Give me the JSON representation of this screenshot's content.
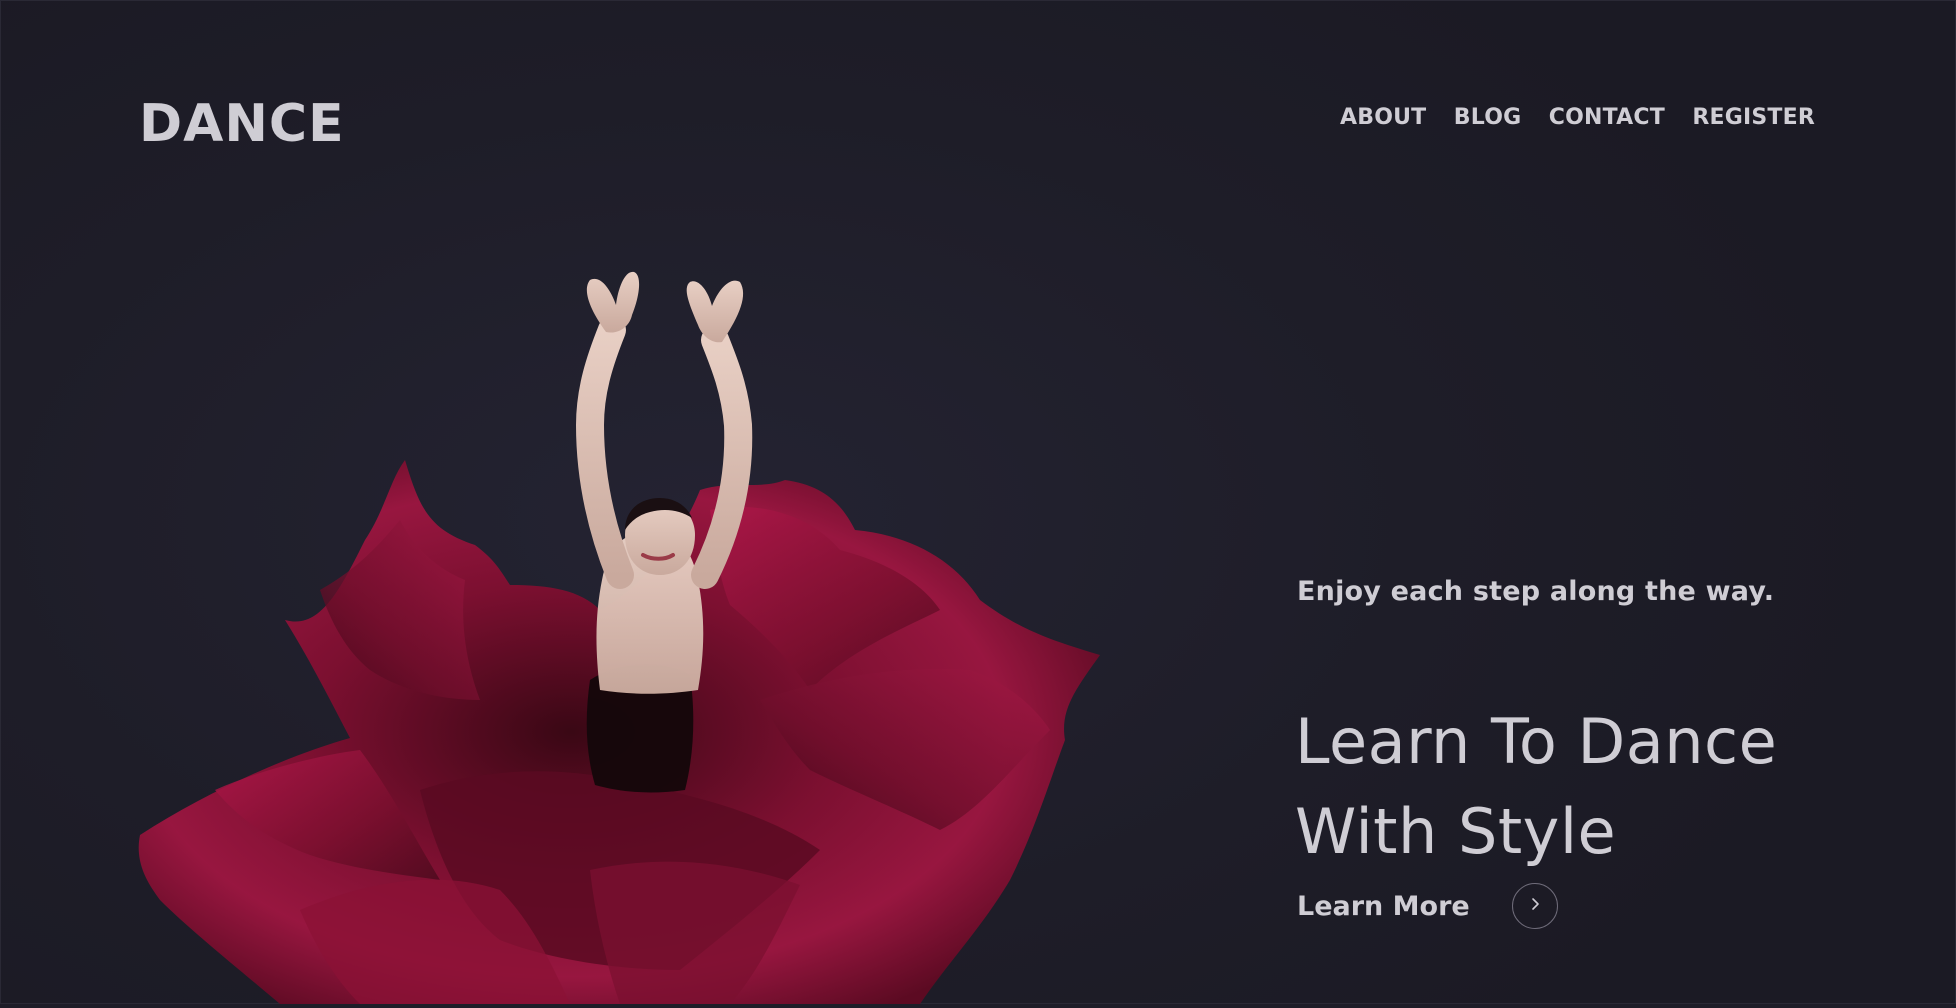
{
  "header": {
    "logo": "DANCE",
    "nav": [
      {
        "label": "ABOUT"
      },
      {
        "label": "BLOG"
      },
      {
        "label": "CONTACT"
      },
      {
        "label": "REGISTER"
      }
    ]
  },
  "hero": {
    "tagline": "Enjoy each step along the way.",
    "headline_line1": "Learn To Dance",
    "headline_line2": "With Style",
    "cta_label": "Learn More",
    "cta_icon": "chevron-right-icon",
    "accent_color": "#8f1238",
    "background_color": "#1e1d28",
    "text_color": "#cfcdd4"
  }
}
